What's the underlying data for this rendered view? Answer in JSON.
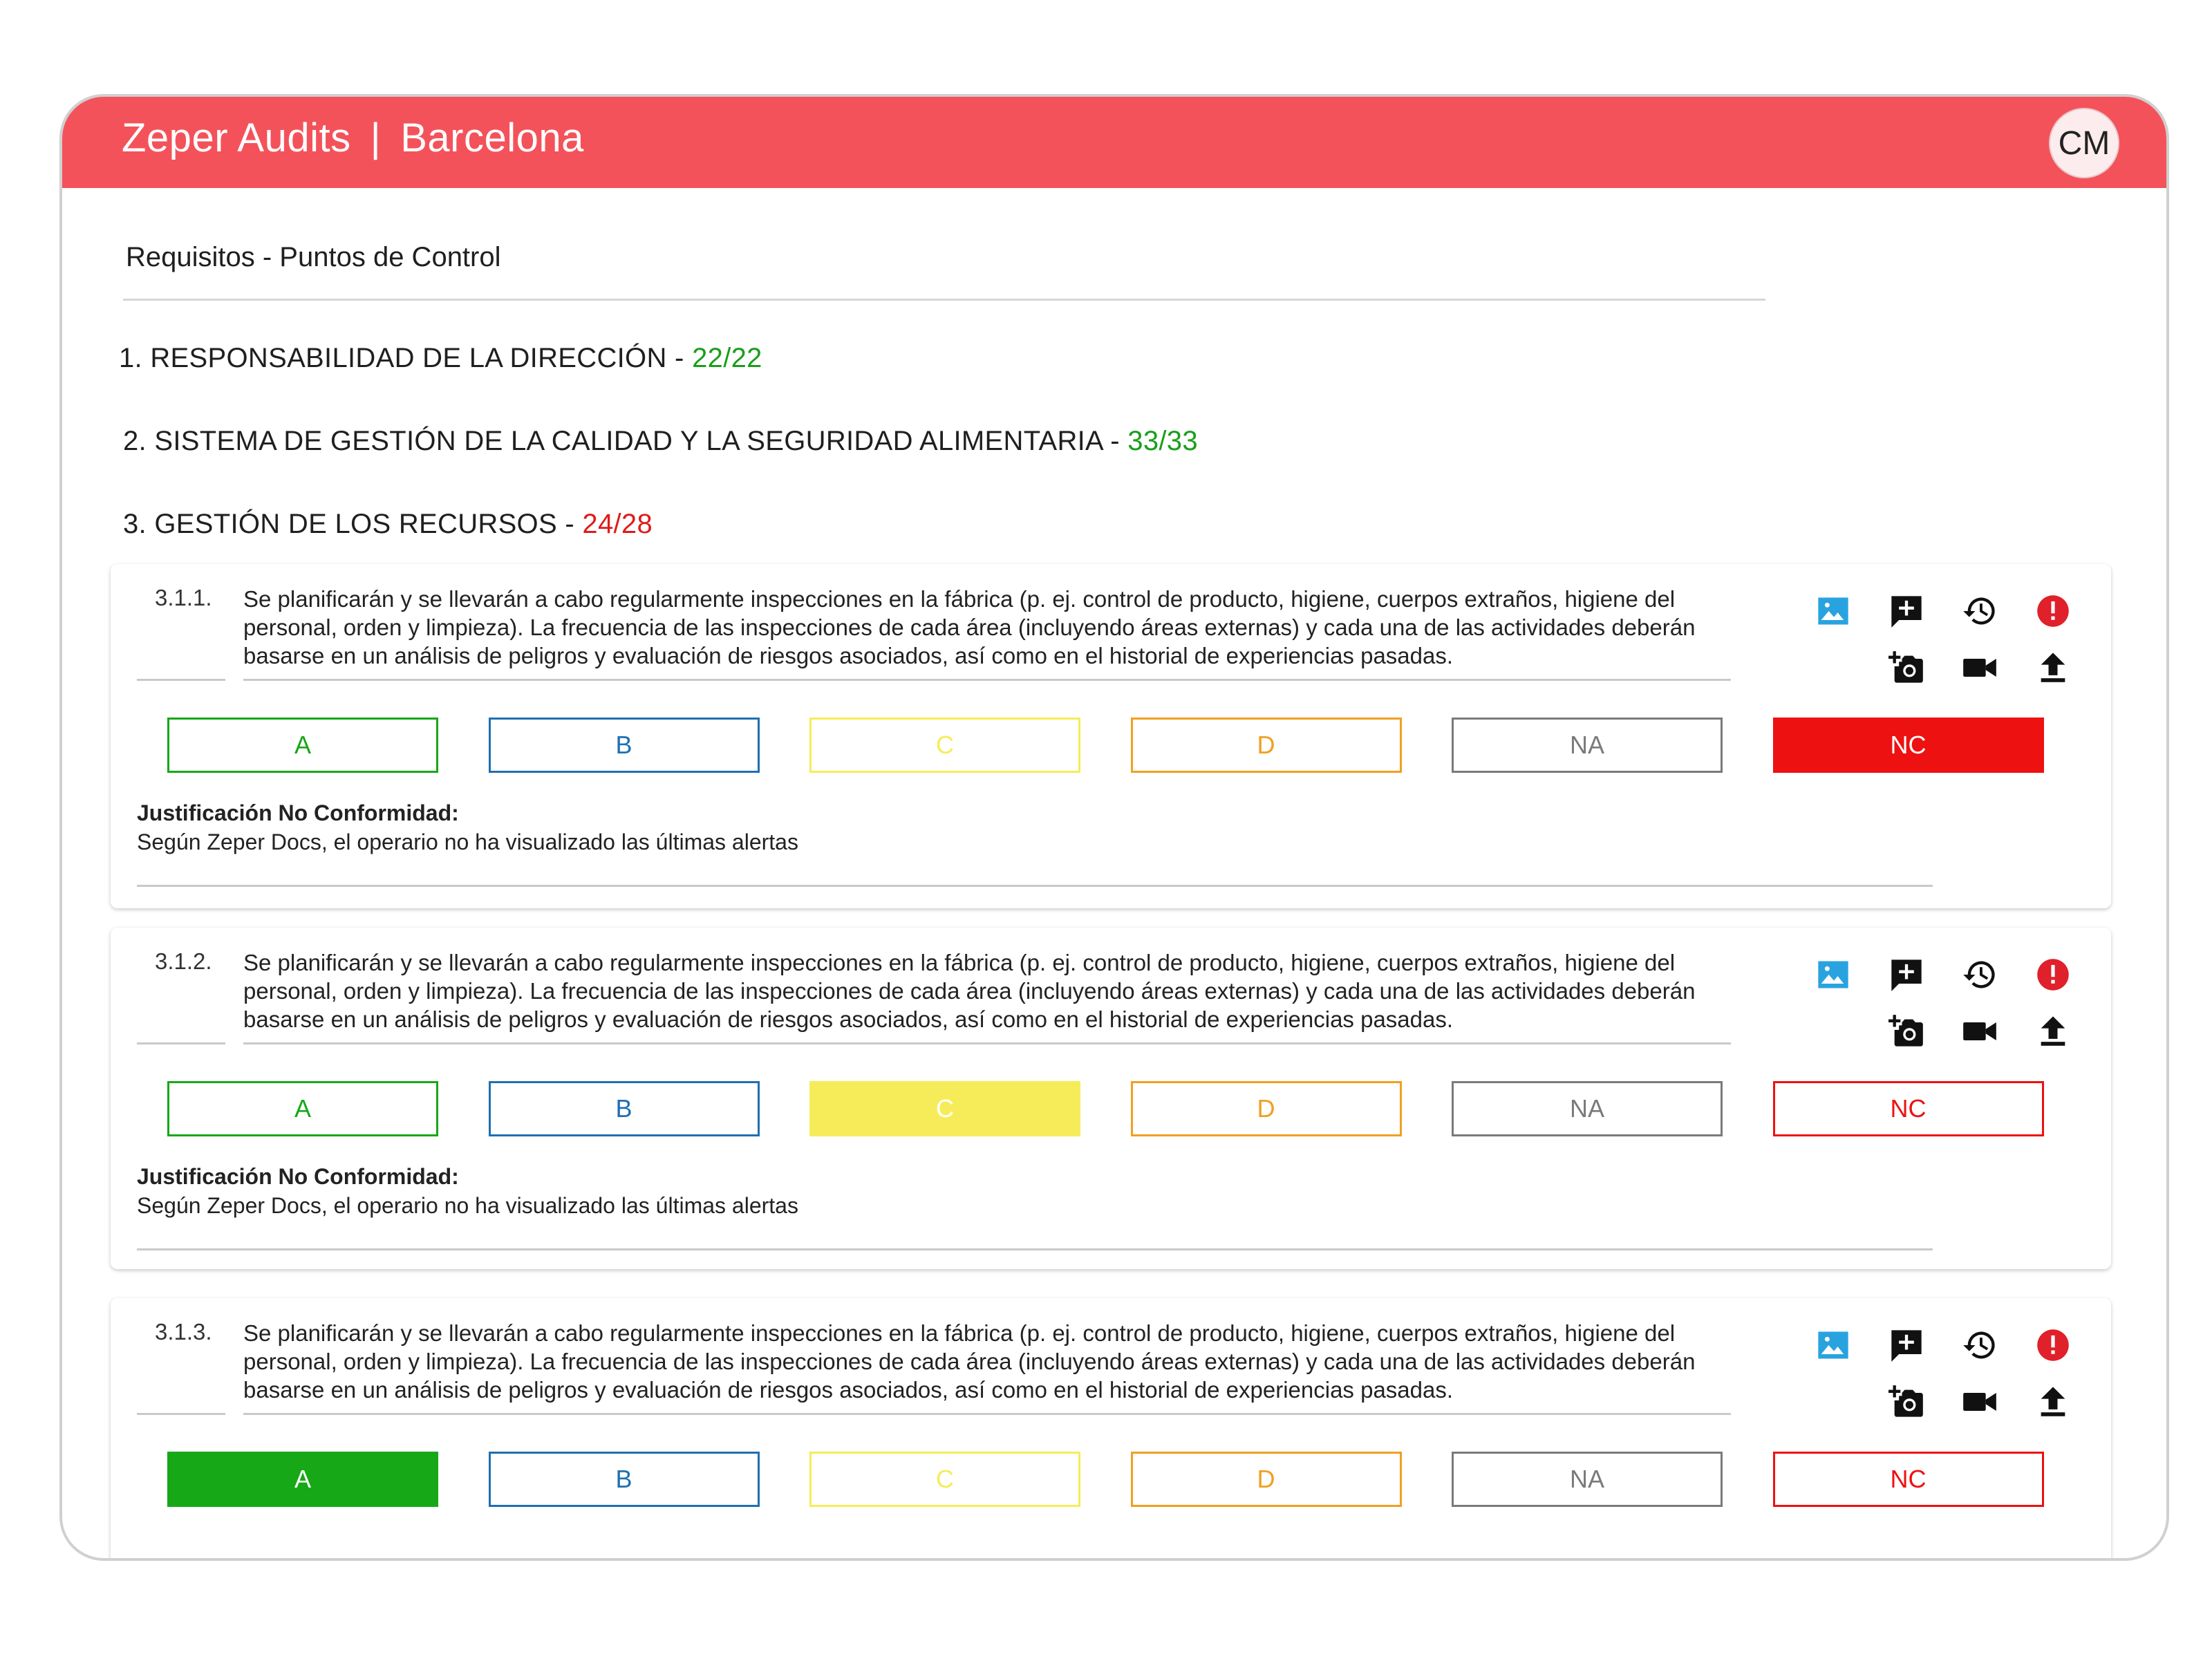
{
  "app": {
    "title": "Zeper Audits",
    "separator": "|",
    "location": "Barcelona",
    "avatar": "CM"
  },
  "breadcrumb": "Requisitos - Puntos de Control",
  "sections": [
    {
      "title": "1. RESPONSABILIDAD DE LA DIRECCIÓN -",
      "score": "22/22",
      "status": "ok"
    },
    {
      "title": "2. SISTEMA DE GESTIÓN DE LA CALIDAD Y LA SEGURIDAD ALIMENTARIA -",
      "score": "33/33",
      "status": "ok"
    },
    {
      "title": "3. GESTIÓN DE LOS RECURSOS -",
      "score": "24/28",
      "status": "bad"
    }
  ],
  "grade_labels": [
    "A",
    "B",
    "C",
    "D",
    "NA",
    "NC"
  ],
  "colors": {
    "A": "#17a817",
    "B": "#1f6fb2",
    "C": "#f6ec5a",
    "D": "#f0a020",
    "NA": "#7a7a7a",
    "NC": "#ee1111",
    "brand": "#f4525a"
  },
  "icon_names": [
    "image-icon",
    "add-comment-icon",
    "history-icon",
    "alert-icon",
    "add-photo-icon",
    "video-icon",
    "upload-icon"
  ],
  "requirements": [
    {
      "code": "3.1.1.",
      "text": "Se planificarán y se llevarán a cabo regularmente inspecciones en la fábrica (p. ej. control de producto, higiene, cuerpos extraños, higiene del personal, orden y limpieza). La frecuencia de las inspecciones de cada área (incluyendo áreas externas) y cada una de las actividades deberán basarse en un análisis de peligros y evaluación de riesgos asociados, así como en el historial de experiencias pasadas.",
      "selected": "NC",
      "justification_label": "Justificación No Conformidad:",
      "justification": "Según Zeper Docs, el operario no ha visualizado las últimas alertas"
    },
    {
      "code": "3.1.2.",
      "text": "Se planificarán y se llevarán a cabo regularmente inspecciones en la fábrica (p. ej. control de producto, higiene, cuerpos extraños, higiene del personal, orden y limpieza). La frecuencia de las inspecciones de cada área (incluyendo áreas externas) y cada una de las actividades deberán basarse en un análisis de peligros y evaluación de riesgos asociados, así como en el historial de experiencias pasadas.",
      "selected": "C",
      "justification_label": "Justificación No Conformidad:",
      "justification": "Según Zeper Docs, el operario no ha visualizado las últimas alertas"
    },
    {
      "code": "3.1.3.",
      "text": "Se planificarán y se llevarán a cabo regularmente inspecciones en la fábrica (p. ej. control de producto, higiene, cuerpos extraños, higiene del personal, orden y limpieza). La frecuencia de las inspecciones de cada área (incluyendo áreas externas) y cada una de las actividades deberán basarse en un análisis de peligros y evaluación de riesgos asociados, así como en el historial de experiencias pasadas.",
      "selected": "A"
    }
  ]
}
